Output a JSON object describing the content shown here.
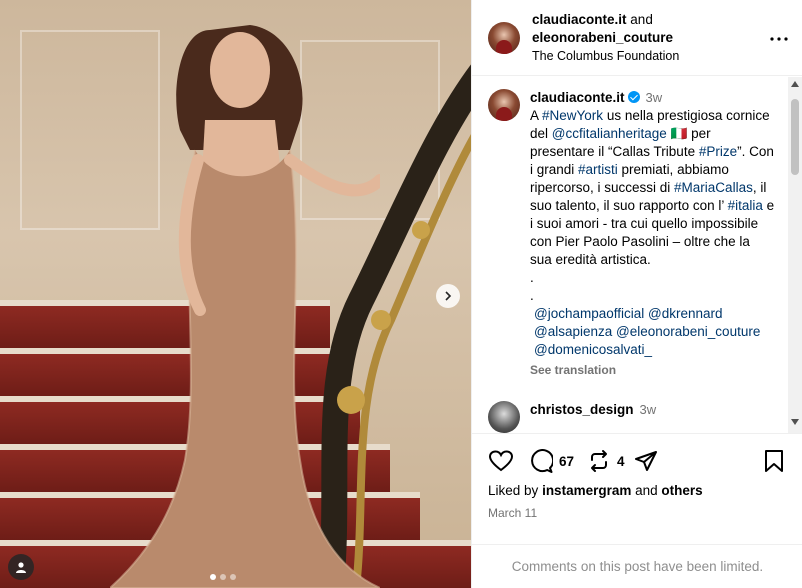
{
  "post": {
    "author_names": "claudiaconte.it",
    "and_text": "and",
    "collaborator": "eleonorabeni_couture",
    "location": "The Columbus Foundation"
  },
  "caption": {
    "user": "claudiaconte.it",
    "time": "3w",
    "parts": [
      {
        "t": "A ",
        "type": "text"
      },
      {
        "t": "#NewYork",
        "type": "link"
      },
      {
        "t": " us nella prestigiosa cornice del ",
        "type": "text"
      },
      {
        "t": "@ccfitalianheritage",
        "type": "link"
      },
      {
        "t": " 🇮🇹 per presentare il “Callas Tribute ",
        "type": "text"
      },
      {
        "t": "#Prize",
        "type": "link"
      },
      {
        "t": "”. Con i grandi ",
        "type": "text"
      },
      {
        "t": "#artisti",
        "type": "link"
      },
      {
        "t": " premiati, abbiamo ripercorso, i successi di ",
        "type": "text"
      },
      {
        "t": "#MariaCallas",
        "type": "link"
      },
      {
        "t": ", il suo talento, il suo rapporto con l’ ",
        "type": "text"
      },
      {
        "t": "#italia",
        "type": "link"
      },
      {
        "t": " e i suoi amori - tra cui quello impossibile con Pier Paolo Pasolini – oltre che la sua eredità artistica.",
        "type": "text"
      }
    ],
    "dot1": ".",
    "dot2": ".",
    "mentions": [
      "@jochampaofficial",
      "@dkrennard",
      "@alsapienza",
      "@eleonorabeni_couture",
      "@domenicosalvati_"
    ],
    "see_translation": "See translation"
  },
  "comment2": {
    "user": "christos_design",
    "time": "3w"
  },
  "actions": {
    "comments_count": "67",
    "shares_count": "4"
  },
  "likes": {
    "prefix": "Liked by",
    "user": "instamergram",
    "and": "and",
    "others": "others"
  },
  "date": "March 11",
  "limited_notice": "Comments on this post have been limited.",
  "colors": {
    "link": "#00376b",
    "verified": "#0095f6",
    "muted": "#737373"
  },
  "icons": [
    "next-arrow-icon",
    "user-tag-icon",
    "more-options-icon",
    "verified-badge-icon",
    "heart-icon",
    "comment-icon",
    "repost-icon",
    "share-icon",
    "bookmark-icon"
  ]
}
